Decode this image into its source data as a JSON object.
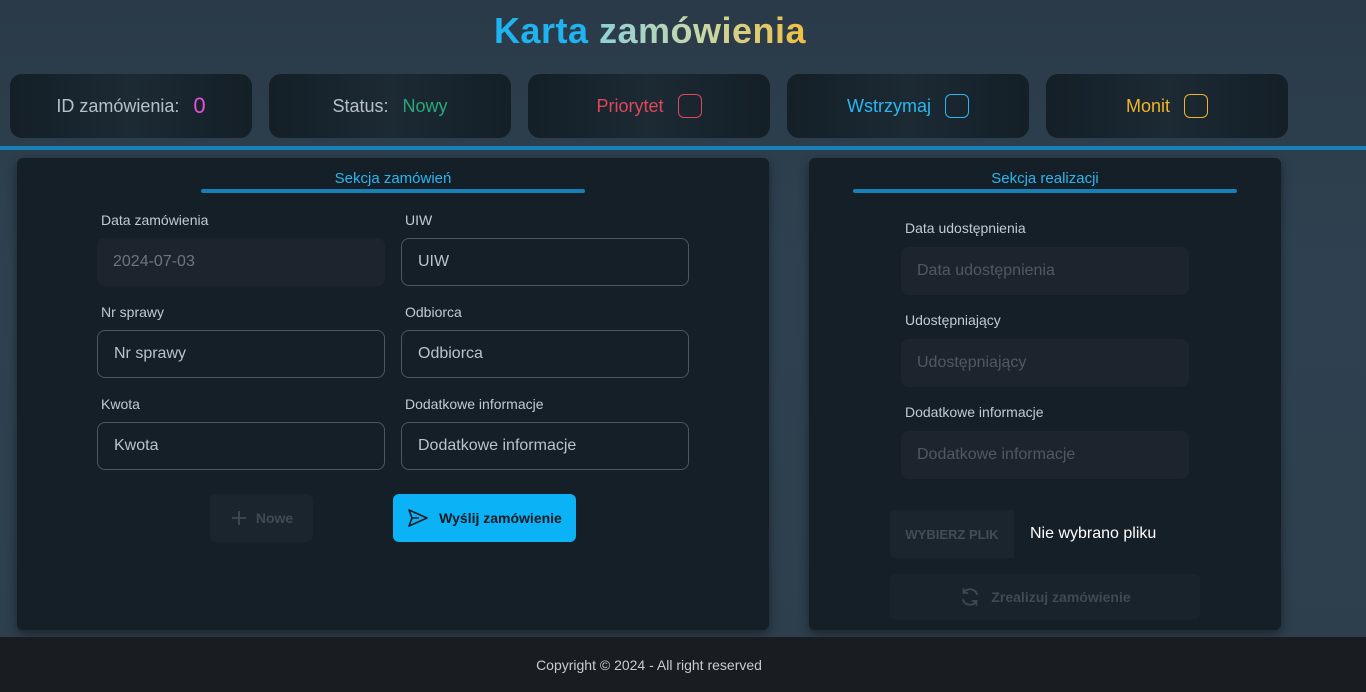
{
  "header": {
    "title_word1": "Karta",
    "title_word2": "zamówienia"
  },
  "topbar": {
    "order_id_label": "ID zamówienia:",
    "order_id_value": "0",
    "status_label": "Status:",
    "status_value": "Nowy",
    "priority_label": "Priorytet",
    "priority_checked": false,
    "hold_label": "Wstrzymaj",
    "hold_checked": false,
    "reminder_label": "Monit",
    "reminder_checked": false
  },
  "order_section": {
    "title": "Sekcja zamówień",
    "date_label": "Data zamówienia",
    "date_value": "2024-07-03",
    "uiw_label": "UIW",
    "uiw_placeholder": "UIW",
    "case_label": "Nr sprawy",
    "case_placeholder": "Nr sprawy",
    "recipient_label": "Odbiorca",
    "recipient_placeholder": "Odbiorca",
    "amount_label": "Kwota",
    "amount_placeholder": "Kwota",
    "info_label": "Dodatkowe informacje",
    "info_placeholder": "Dodatkowe informacje",
    "new_button": "Nowe",
    "send_button": "Wyślij zamówienie"
  },
  "realization_section": {
    "title": "Sekcja realizacji",
    "share_date_label": "Data udostępnienia",
    "share_date_placeholder": "Data udostępnienia",
    "sharer_label": "Udostępniający",
    "sharer_placeholder": "Udostępniający",
    "info_label": "Dodatkowe informacje",
    "info_placeholder": "Dodatkowe informacje",
    "file_button": "WYBIERZ PLIK",
    "file_status": "Nie wybrano pliku",
    "realize_button": "Zrealizuj zamówienie"
  },
  "footer": {
    "copyright": "Copyright © 2024 - All right reserved"
  },
  "colors": {
    "accent": "#0bb2f5",
    "priority": "#e0475a",
    "hold": "#2bb6f0",
    "reminder": "#f0b429",
    "order_id": "#e64fd8",
    "status_new": "#2aa87a"
  },
  "icons": [
    "plus-icon",
    "send-icon",
    "refresh-icon"
  ]
}
